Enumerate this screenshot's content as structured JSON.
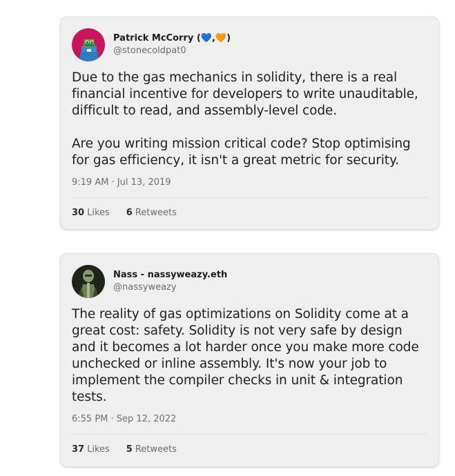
{
  "tweets": [
    {
      "author_name": "Patrick McCorry (💙,🧡)",
      "author_handle": "@stonecoldpat0",
      "avatar_icon": "pixel-frog-avatar",
      "text": "Due to the gas mechanics in solidity, there is a real financial incentive for developers to write unauditable, difficult to read, and assembly-level code.\n\nAre you writing mission critical code? Stop optimising for gas efficiency, it isn't a great metric for security.",
      "time": "9:19 AM · Jul 13, 2019",
      "likes_count": "30",
      "likes_label": "Likes",
      "retweets_count": "6",
      "retweets_label": "Retweets"
    },
    {
      "author_name": "Nass - nassyweazy.eth",
      "author_handle": "@nassyweazy",
      "avatar_icon": "robot-figure-avatar",
      "text": "The reality of gas optimizations on Solidity come at a great cost: safety. Solidity is not very safe by design and it becomes a lot harder once you make more code unchecked or inline assembly. It's now your job to implement the compiler checks in unit & integration tests.",
      "time": "6:55 PM · Sep 12, 2022",
      "likes_count": "37",
      "likes_label": "Likes",
      "retweets_count": "5",
      "retweets_label": "Retweets"
    }
  ],
  "colors": {
    "card_background": "#efefef",
    "text": "#1f1f1f",
    "muted": "#6b6b6b",
    "avatar1_background": "#c8155d",
    "avatar2_background": "#1e2416"
  }
}
